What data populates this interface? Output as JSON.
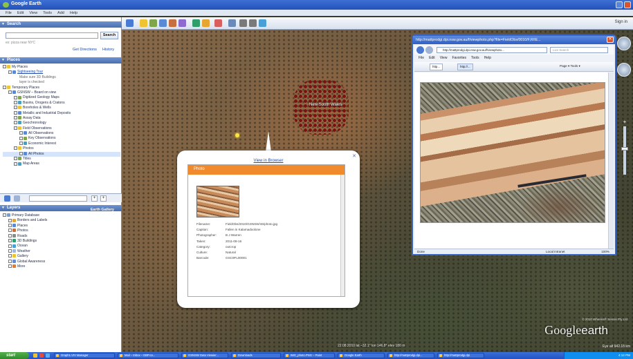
{
  "window": {
    "title": "Google Earth"
  },
  "menubar": [
    "File",
    "Edit",
    "View",
    "Tools",
    "Add",
    "Help"
  ],
  "toolbar": {
    "sign_in": "Sign in"
  },
  "search": {
    "header": "Search",
    "button": "Search",
    "hint": "ex: pizza near NYC",
    "get_directions": "Get Directions",
    "history": "History"
  },
  "places": {
    "header": "Places",
    "items": [
      {
        "label": "My Places",
        "level": 0,
        "type": "plain"
      },
      {
        "label": "Sightseeing Tour",
        "level": 1,
        "type": "link"
      },
      {
        "label": "Make sure 3D Buildings",
        "level": 3,
        "type": "sub"
      },
      {
        "label": "layer is checked",
        "level": 3,
        "type": "sub"
      },
      {
        "label": "Temporary Places",
        "level": 0,
        "type": "plain"
      },
      {
        "label": "GSNSW – Board on view",
        "level": 1,
        "type": "plain"
      },
      {
        "label": "Digitized Geology Maps",
        "level": 2,
        "type": "plain"
      },
      {
        "label": "Basins, Orogens & Cratons",
        "level": 2,
        "type": "plain"
      },
      {
        "label": "Boreholes & Wells",
        "level": 2,
        "type": "plain"
      },
      {
        "label": "Metallic and Industrial Deposits",
        "level": 2,
        "type": "plain"
      },
      {
        "label": "Assay Data",
        "level": 2,
        "type": "plain"
      },
      {
        "label": "Geochronology",
        "level": 2,
        "type": "plain"
      },
      {
        "label": "Field Observations",
        "level": 2,
        "type": "plain"
      },
      {
        "label": "All Observations",
        "level": 3,
        "type": "plain"
      },
      {
        "label": "Key Observations",
        "level": 3,
        "type": "plain"
      },
      {
        "label": "Economic Interest",
        "level": 3,
        "type": "plain"
      },
      {
        "label": "Photos",
        "level": 2,
        "type": "plain"
      },
      {
        "label": "All Photos",
        "level": 3,
        "type": "selected"
      },
      {
        "label": "Titles",
        "level": 2,
        "type": "plain"
      },
      {
        "label": "Map Areas",
        "level": 2,
        "type": "plain"
      }
    ]
  },
  "layers": {
    "header": "Layers",
    "gallery": "Earth Gallery",
    "items": [
      {
        "label": "Primary Database",
        "level": 0
      },
      {
        "label": "Borders and Labels",
        "level": 1
      },
      {
        "label": "Places",
        "level": 1
      },
      {
        "label": "Photos",
        "level": 1
      },
      {
        "label": "Roads",
        "level": 1
      },
      {
        "label": "3D Buildings",
        "level": 1
      },
      {
        "label": "Ocean",
        "level": 1
      },
      {
        "label": "Weather",
        "level": 1
      },
      {
        "label": "Gallery",
        "level": 1
      },
      {
        "label": "Global Awareness",
        "level": 1
      },
      {
        "label": "More",
        "level": 1
      }
    ]
  },
  "map": {
    "region_label": "New South Wales",
    "status_line": "22.08.2010  lat  –32.1°  lon  146.8°  elev  180 m",
    "attribution": "© 2010 Whereis® Sensis Pty Ltd",
    "eye_alt": "Eye alt  942.18 km"
  },
  "balloon": {
    "view_in_browser": "View in Browser",
    "header": "Photo",
    "fields": [
      {
        "key": "Filename:",
        "value": "FieldObs/2010/GSNSW/46/photo.jpg"
      },
      {
        "key": "Caption:",
        "value": "Fallen in Kalamadoolone"
      },
      {
        "key": "Photographer:",
        "value": "B J Warren"
      },
      {
        "key": "Taken:",
        "value": "2011-08-16"
      },
      {
        "key": "Category:",
        "value": "outcrop"
      },
      {
        "key": "Culture:",
        "value": "Natural"
      },
      {
        "key": "Barcode:",
        "value": "GSC9FL00001"
      }
    ]
  },
  "ie": {
    "title": "http://mattprodgi.dpi.nsw.gov.au/f/viewphoto.php?file=FieldObs/0010/F,R/IE...",
    "url": "http://mattprodgi.dpi.nsw.gov.au/f/viewphoto...",
    "search_placeholder": "Live Search",
    "menu": [
      "File",
      "Edit",
      "View",
      "Favorites",
      "Tools",
      "Help"
    ],
    "tab1": "http...",
    "tab2": "http://...",
    "tools": "Page ▾   Tools ▾",
    "status_done": "Done",
    "status_zone": "Local intranet",
    "status_zoom": "100%"
  },
  "taskbar": {
    "start": "start",
    "tasks": [
      "Graph1.VIV Manager",
      "Mail – Inbox – DBP.co...",
      "GSNSW Data Viewier...",
      "Downloads",
      "IMG_photo.PNG – Paint",
      "Google Earth",
      "http://mattprodgi.dpi...",
      "http://mattprodgi.dpi"
    ],
    "clock": "4:12 PM"
  },
  "colors": {
    "title_blue": "#2f5fc4",
    "orange_header": "#f18a2c",
    "link_blue": "#1a47a8"
  }
}
